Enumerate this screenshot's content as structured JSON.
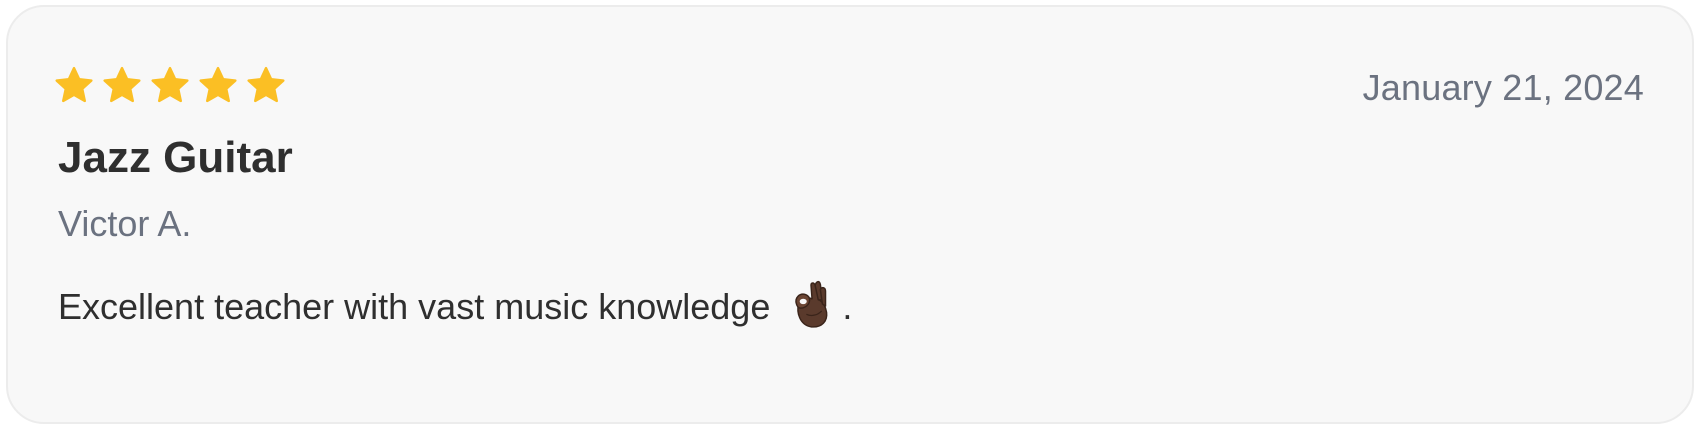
{
  "review": {
    "rating": 5,
    "rating_max": 5,
    "date": "January 21, 2024",
    "title": "Jazz Guitar",
    "reviewer": "Victor A.",
    "text": "Excellent teacher with vast music knowledge",
    "text_end": ".",
    "text_icon": "ok-hand-icon"
  },
  "colors": {
    "star": "#fbbf24",
    "card_background": "#f8f8f8",
    "card_border": "#ececec",
    "muted_text": "#6b7280",
    "body_text": "#2f2f2f"
  }
}
